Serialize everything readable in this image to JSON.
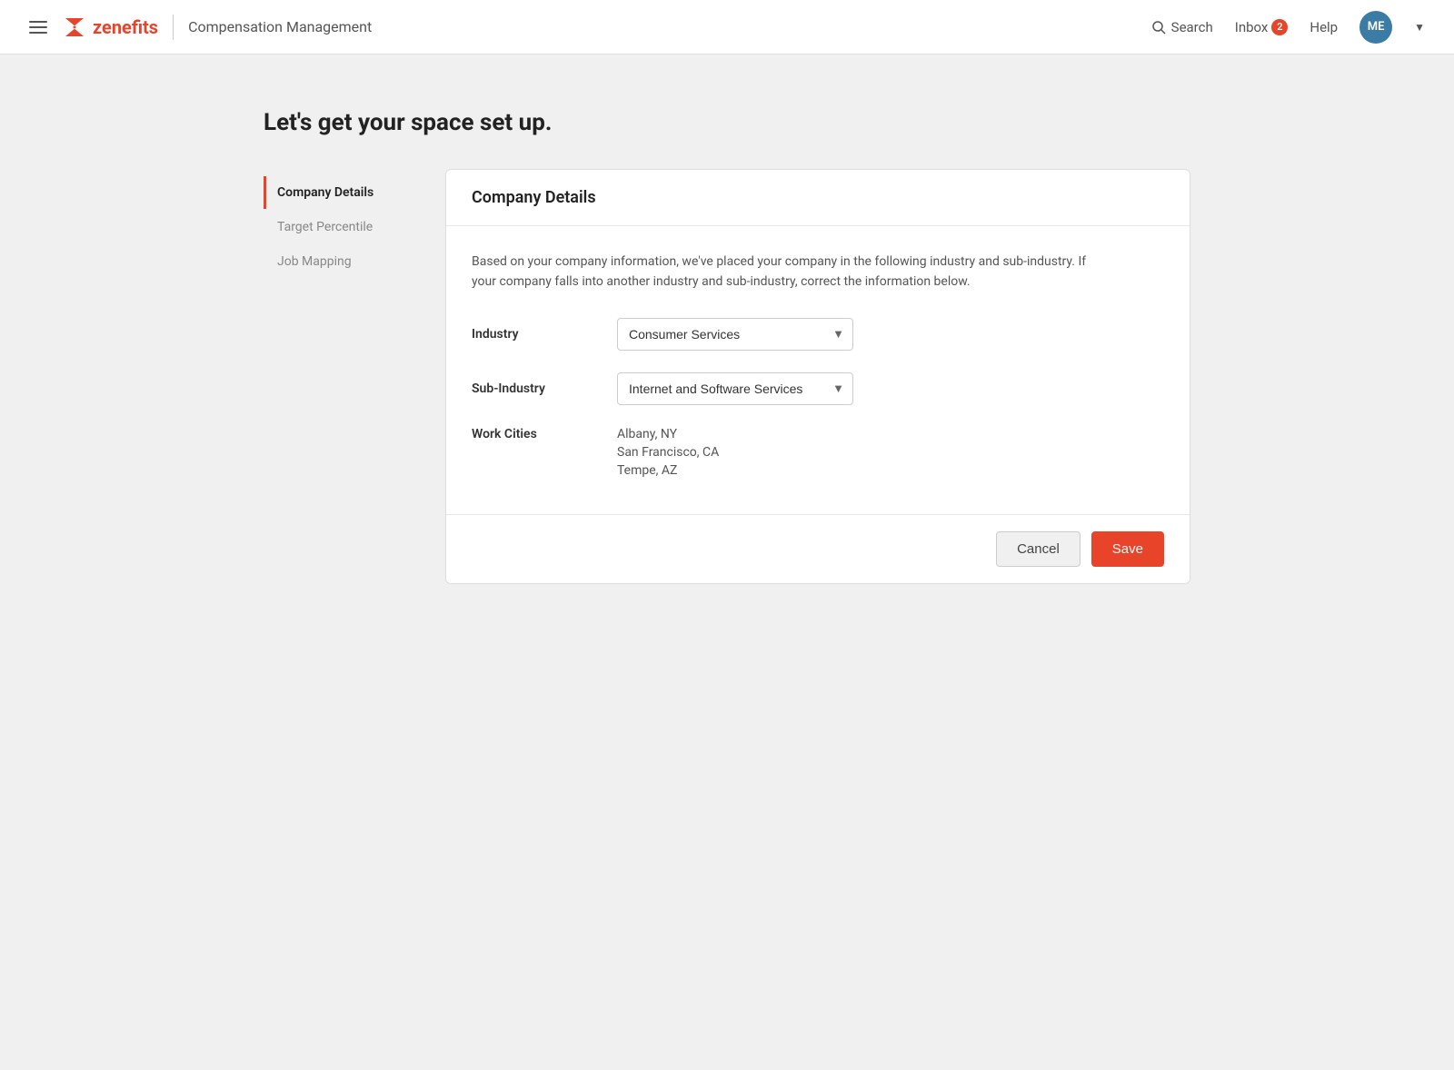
{
  "header": {
    "logo_text": "zenefits",
    "logo_z": "z",
    "app_name": "Compensation Management",
    "search_label": "Search",
    "inbox_label": "Inbox",
    "inbox_count": "2",
    "help_label": "Help",
    "avatar_initials": "ME"
  },
  "page": {
    "title": "Let's get your space set up.",
    "sidebar": {
      "items": [
        {
          "id": "company-details",
          "label": "Company Details",
          "active": true
        },
        {
          "id": "target-percentile",
          "label": "Target Percentile",
          "active": false
        },
        {
          "id": "job-mapping",
          "label": "Job Mapping",
          "active": false
        }
      ]
    },
    "card": {
      "title": "Company Details",
      "description": "Based on your company information, we've placed your company in the following industry and sub-industry. If your company falls into another industry and sub-industry, correct the information below.",
      "fields": {
        "industry_label": "Industry",
        "industry_value": "Consumer Services",
        "subindustry_label": "Sub-Industry",
        "subindustry_value": "Internet and Software Services",
        "workcities_label": "Work Cities",
        "work_cities": [
          {
            "city": "Albany, NY"
          },
          {
            "city": "San Francisco, CA"
          },
          {
            "city": "Tempe, AZ"
          }
        ]
      },
      "actions": {
        "cancel_label": "Cancel",
        "save_label": "Save"
      }
    }
  }
}
